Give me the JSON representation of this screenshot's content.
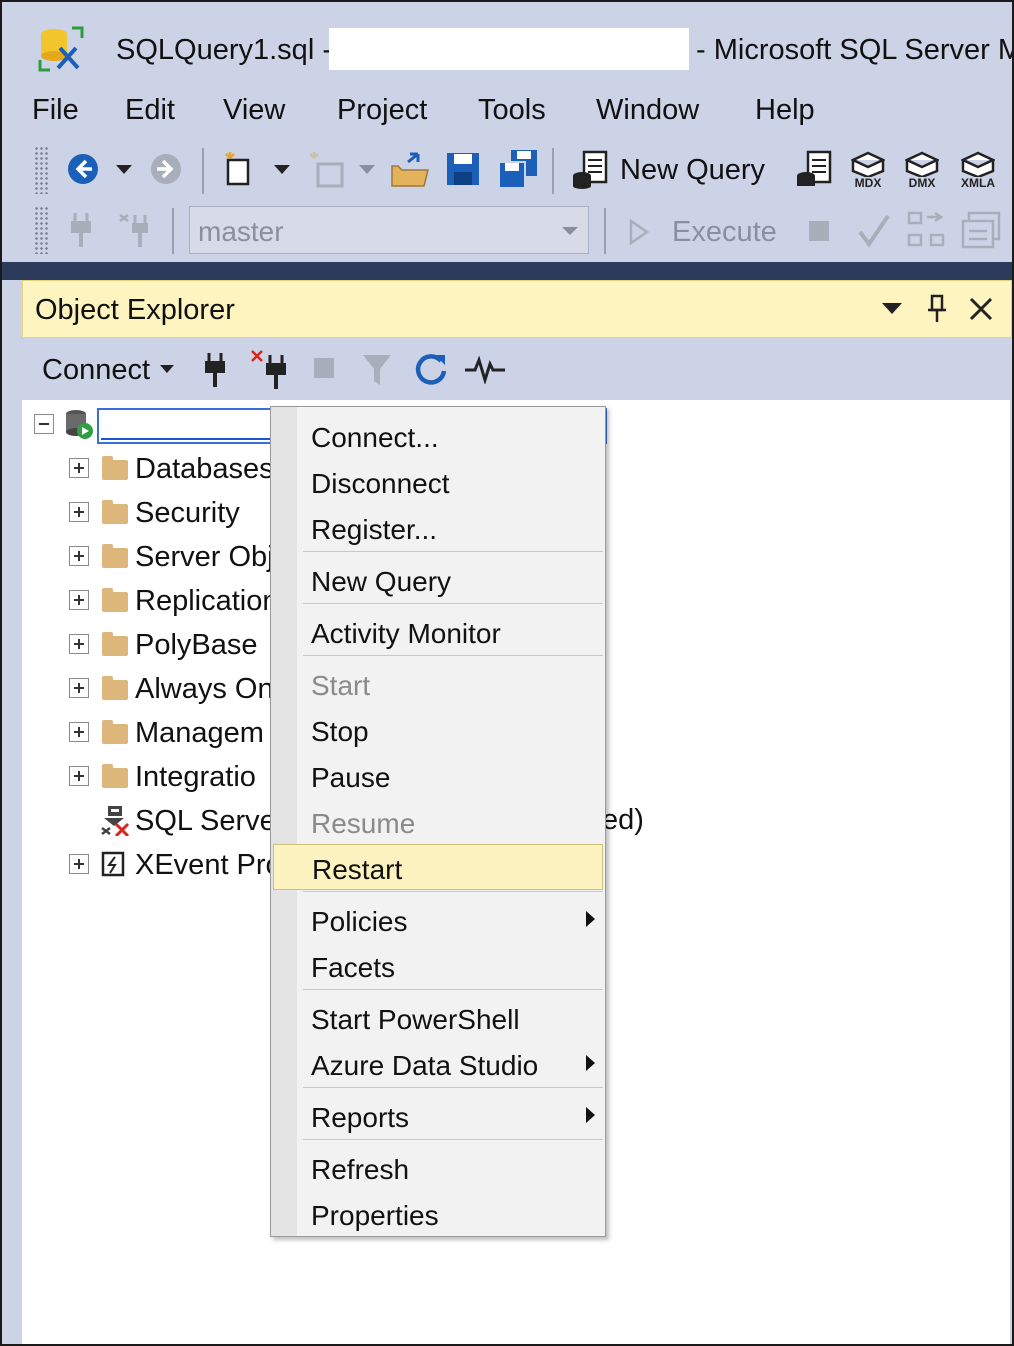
{
  "window": {
    "title": "SQLQuery1.sql -",
    "title_suffix": "- Microsoft SQL Server M"
  },
  "menu": {
    "items": [
      "File",
      "Edit",
      "View",
      "Project",
      "Tools",
      "Window",
      "Help"
    ]
  },
  "toolbar": {
    "new_query_label": "New Query",
    "mdx_label": "MDX",
    "dmx_label": "DMX",
    "xmla_label": "XMLA",
    "database_value": "master",
    "execute_label": "Execute"
  },
  "object_explorer": {
    "title": "Object Explorer",
    "connect_label": "Connect",
    "tree": [
      {
        "label": "Databases",
        "type": "folder"
      },
      {
        "label": "Security",
        "type": "folder"
      },
      {
        "label": "Server Obj",
        "type": "folder"
      },
      {
        "label": "Replication",
        "type": "folder"
      },
      {
        "label": "PolyBase",
        "type": "folder"
      },
      {
        "label": "Always On",
        "type": "folder"
      },
      {
        "label": "Managem",
        "type": "folder"
      },
      {
        "label": "Integratio",
        "type": "folder"
      },
      {
        "label": "SQL Serve",
        "type": "agent"
      },
      {
        "label": "XEvent Pro",
        "type": "xevent"
      }
    ],
    "agent_suffix": "ed)"
  },
  "context_menu": {
    "items": [
      {
        "label": "Connect...",
        "disabled": false
      },
      {
        "label": "Disconnect",
        "disabled": false
      },
      {
        "label": "Register...",
        "disabled": false
      },
      {
        "label": "New Query",
        "disabled": false
      },
      {
        "label": "Activity Monitor",
        "disabled": false
      },
      {
        "label": "Start",
        "disabled": true
      },
      {
        "label": "Stop",
        "disabled": false
      },
      {
        "label": "Pause",
        "disabled": false
      },
      {
        "label": "Resume",
        "disabled": true
      },
      {
        "label": "Restart",
        "disabled": false,
        "highlighted": true
      },
      {
        "label": "Policies",
        "disabled": false,
        "submenu": true
      },
      {
        "label": "Facets",
        "disabled": false
      },
      {
        "label": "Start PowerShell",
        "disabled": false
      },
      {
        "label": "Azure Data Studio",
        "disabled": false,
        "submenu": true
      },
      {
        "label": "Reports",
        "disabled": false,
        "submenu": true
      },
      {
        "label": "Refresh",
        "disabled": false
      },
      {
        "label": "Properties",
        "disabled": false
      }
    ]
  },
  "colors": {
    "chrome": "#cdd3e6",
    "oe_header": "#fdf4bf",
    "highlight": "#fcf3c0",
    "accent_blue": "#1c5fb8",
    "dark_band": "#2c3b5c"
  }
}
